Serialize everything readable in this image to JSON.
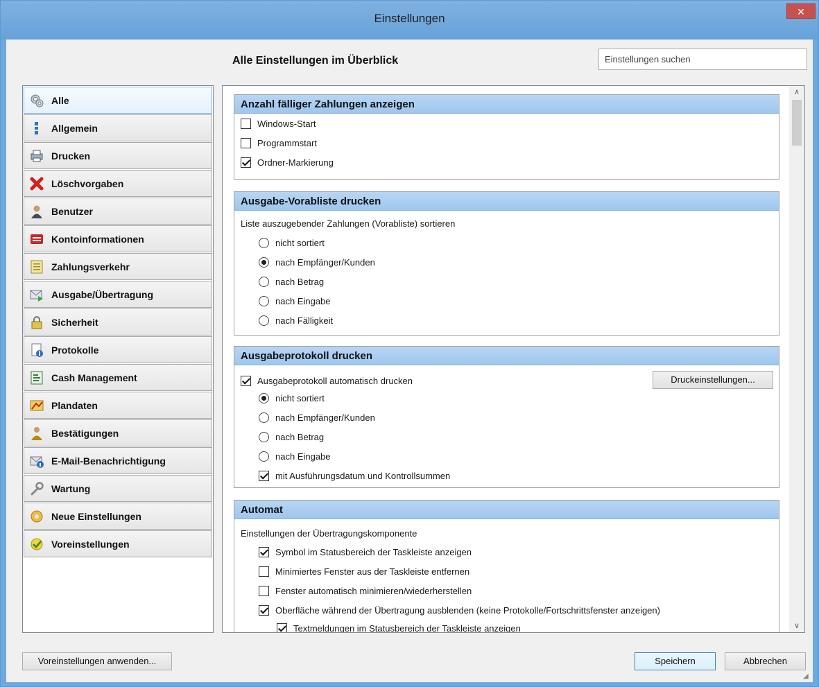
{
  "window": {
    "title": "Einstellungen",
    "close_label": "✕"
  },
  "header": {
    "title": "Alle Einstellungen im Überblick",
    "search_placeholder": "Einstellungen suchen"
  },
  "sidebar": {
    "items": [
      {
        "label": "Alle",
        "icon": "gears-icon"
      },
      {
        "label": "Allgemein",
        "icon": "general-icon"
      },
      {
        "label": "Drucken",
        "icon": "printer-icon"
      },
      {
        "label": "Löschvorgaben",
        "icon": "delete-icon"
      },
      {
        "label": "Benutzer",
        "icon": "user-icon"
      },
      {
        "label": "Kontoinformationen",
        "icon": "account-icon"
      },
      {
        "label": "Zahlungsverkehr",
        "icon": "payment-icon"
      },
      {
        "label": "Ausgabe/Übertragung",
        "icon": "transfer-icon"
      },
      {
        "label": "Sicherheit",
        "icon": "lock-icon"
      },
      {
        "label": "Protokolle",
        "icon": "log-icon"
      },
      {
        "label": "Cash Management",
        "icon": "cash-icon"
      },
      {
        "label": "Plandaten",
        "icon": "plan-icon"
      },
      {
        "label": "Bestätigungen",
        "icon": "confirm-icon"
      },
      {
        "label": "E-Mail-Benachrichtigung",
        "icon": "email-icon"
      },
      {
        "label": "Wartung",
        "icon": "wrench-icon"
      },
      {
        "label": "Neue Einstellungen",
        "icon": "new-settings-icon"
      },
      {
        "label": "Voreinstellungen",
        "icon": "presets-icon"
      }
    ]
  },
  "groups": {
    "g1": {
      "title": "Anzahl fälliger Zahlungen anzeigen",
      "options": [
        {
          "label": "Windows-Start",
          "checked": false
        },
        {
          "label": "Programmstart",
          "checked": false
        },
        {
          "label": "Ordner-Markierung",
          "checked": true
        }
      ]
    },
    "g2": {
      "title": "Ausgabe-Vorabliste drucken",
      "intro": "Liste auszugebender Zahlungen (Vorabliste) sortieren",
      "options": [
        {
          "label": "nicht sortiert",
          "checked": false
        },
        {
          "label": "nach Empfänger/Kunden",
          "checked": true
        },
        {
          "label": "nach Betrag",
          "checked": false
        },
        {
          "label": "nach Eingabe",
          "checked": false
        },
        {
          "label": "nach Fälligkeit",
          "checked": false
        }
      ]
    },
    "g3": {
      "title": "Ausgabeprotokoll drucken",
      "auto_print": {
        "label": "Ausgabeprotokoll automatisch drucken",
        "checked": true
      },
      "print_settings_button": "Druckeinstellungen...",
      "options": [
        {
          "label": "nicht sortiert",
          "checked": true
        },
        {
          "label": "nach Empfänger/Kunden",
          "checked": false
        },
        {
          "label": "nach Betrag",
          "checked": false
        },
        {
          "label": "nach Eingabe",
          "checked": false
        }
      ],
      "with_date": {
        "label": "mit Ausführungsdatum und Kontrollsummen",
        "checked": true
      }
    },
    "g4": {
      "title": "Automat",
      "intro": "Einstellungen der Übertragungskomponente",
      "options": [
        {
          "label": "Symbol im Statusbereich der Taskleiste anzeigen",
          "checked": true
        },
        {
          "label": "Minimiertes Fenster aus der Taskleiste entfernen",
          "checked": false
        },
        {
          "label": "Fenster automatisch minimieren/wiederherstellen",
          "checked": false
        },
        {
          "label": "Oberfläche während der Übertragung ausblenden (keine Protokolle/Fortschrittsfenster anzeigen)",
          "checked": true
        },
        {
          "label": "Textmeldungen im Statusbereich der Taskleiste anzeigen",
          "checked": true
        }
      ]
    }
  },
  "footer": {
    "apply_presets_button": "Voreinstellungen anwenden...",
    "save_button": "Speichern",
    "cancel_button": "Abbrechen"
  },
  "colors": {
    "titlebar": "#6fa8dc",
    "group_header": "#a6cbf0",
    "close_button": "#c75050"
  }
}
